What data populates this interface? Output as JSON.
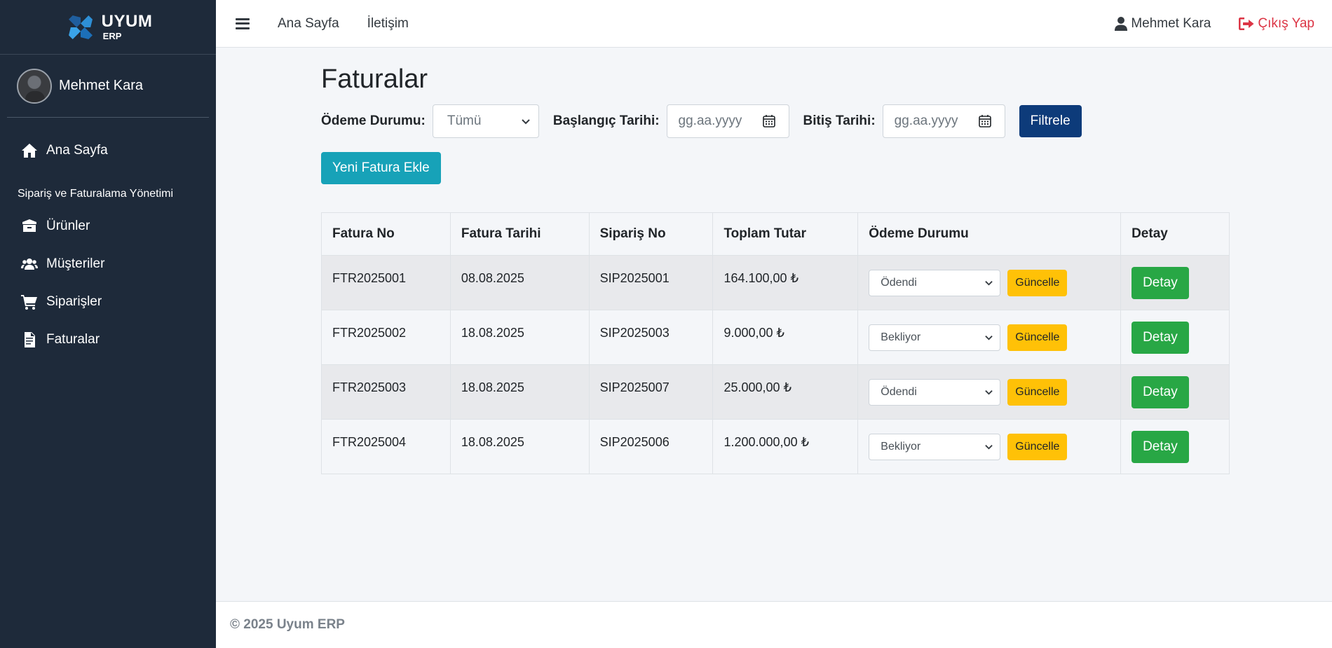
{
  "brand": {
    "name": "UYUM",
    "sub": "ERP"
  },
  "sidebar": {
    "user_name": "Mehmet Kara",
    "home": "Ana Sayfa",
    "section_header": "Sipariş ve Faturalama Yönetimi",
    "items": [
      {
        "label": "Ürünler",
        "icon": "box-icon"
      },
      {
        "label": "Müşteriler",
        "icon": "users-icon"
      },
      {
        "label": "Siparişler",
        "icon": "cart-icon"
      },
      {
        "label": "Faturalar",
        "icon": "invoice-icon"
      }
    ]
  },
  "topbar": {
    "links": [
      "Ana Sayfa",
      "İletişim"
    ],
    "user_name": "Mehmet Kara",
    "logout": "Çıkış Yap"
  },
  "page": {
    "title": "Faturalar",
    "filters": {
      "status_label": "Ödeme Durumu:",
      "status_value": "Tümü",
      "start_label": "Başlangıç Tarihi:",
      "start_placeholder": "gg.aa.yyyy",
      "end_label": "Bitiş Tarihi:",
      "end_placeholder": "gg.aa.yyyy",
      "filter_button": "Filtrele"
    },
    "new_button": "Yeni Fatura Ekle",
    "table": {
      "headers": [
        "Fatura No",
        "Fatura Tarihi",
        "Sipariş No",
        "Toplam Tutar",
        "Ödeme Durumu",
        "Detay"
      ],
      "rows": [
        {
          "invoice_no": "FTR2025001",
          "date": "08.08.2025",
          "order_no": "SIP2025001",
          "total": "164.100,00 ₺",
          "status": "Ödendi",
          "update": "Güncelle",
          "detail": "Detay"
        },
        {
          "invoice_no": "FTR2025002",
          "date": "18.08.2025",
          "order_no": "SIP2025003",
          "total": "9.000,00 ₺",
          "status": "Bekliyor",
          "update": "Güncelle",
          "detail": "Detay"
        },
        {
          "invoice_no": "FTR2025003",
          "date": "18.08.2025",
          "order_no": "SIP2025007",
          "total": "25.000,00 ₺",
          "status": "Ödendi",
          "update": "Güncelle",
          "detail": "Detay"
        },
        {
          "invoice_no": "FTR2025004",
          "date": "18.08.2025",
          "order_no": "SIP2025006",
          "total": "1.200.000,00 ₺",
          "status": "Bekliyor",
          "update": "Güncelle",
          "detail": "Detay"
        }
      ]
    }
  },
  "footer": {
    "text": "© 2025 Uyum ERP"
  },
  "colors": {
    "sidebar": "#1e2a3a",
    "primary": "#0d3b7a",
    "info": "#17a2b8",
    "warning": "#ffc107",
    "success": "#28a745",
    "danger": "#dc3545"
  }
}
